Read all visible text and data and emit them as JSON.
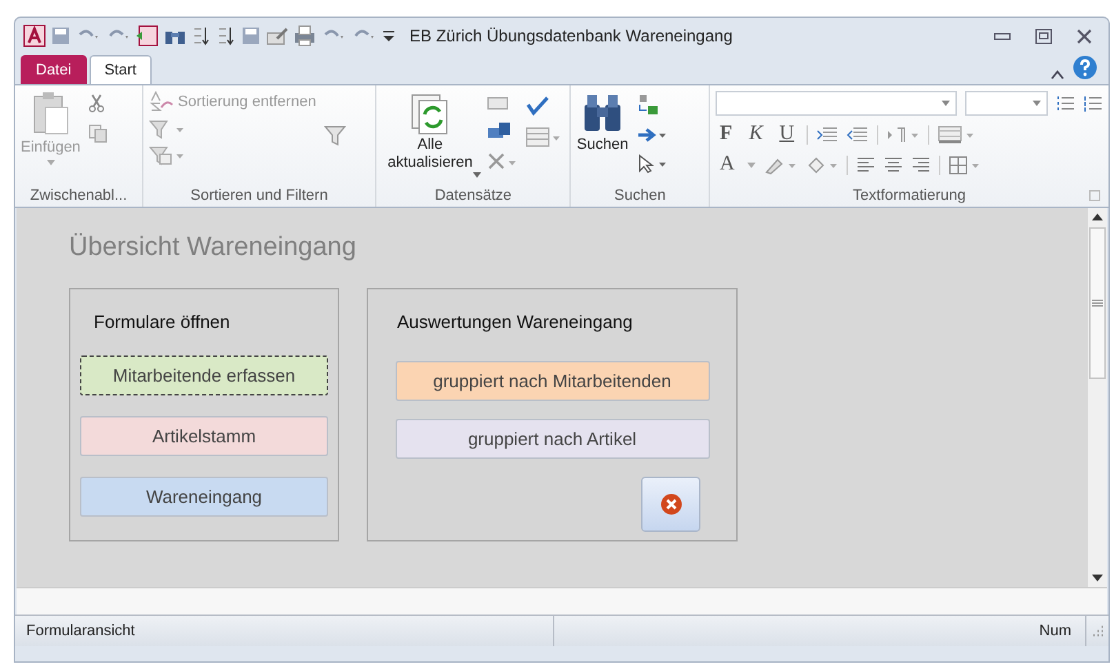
{
  "window": {
    "title": "EB Zürich Übungsdatenbank Wareneingang"
  },
  "tabs": [
    {
      "label": "Datei",
      "kind": "file",
      "selected": false
    },
    {
      "label": "Start",
      "kind": "tab",
      "selected": true
    }
  ],
  "ribbon": {
    "groups": [
      {
        "kind": "clipboard",
        "label": "Zwischenabl...",
        "texts": [
          "Einfügen"
        ]
      },
      {
        "kind": "sort",
        "label": "Sortieren und Filtern",
        "texts": [
          "Sortierung entfernen"
        ]
      },
      {
        "kind": "records",
        "label": "Datensätze",
        "texts": [
          "Alle",
          "aktualisieren"
        ]
      },
      {
        "kind": "find",
        "label": "Suchen",
        "texts": [
          "Suchen"
        ]
      },
      {
        "kind": "text",
        "label": "Textformatierung",
        "texts": [
          "F",
          "K",
          "U",
          "A"
        ]
      }
    ]
  },
  "form": {
    "title": "Übersicht Wareneingang",
    "panels": [
      {
        "title": "Formulare öffnen",
        "close_button": false,
        "buttons": [
          {
            "label": "Mitarbeitende erfassen",
            "color": "#d9e9c6",
            "focused": true
          },
          {
            "label": "Artikelstamm",
            "color": "#f3dada",
            "focused": false
          },
          {
            "label": "Wareneingang",
            "color": "#c8daf1",
            "focused": false
          }
        ]
      },
      {
        "title": "Auswertungen Wareneingang",
        "close_button": true,
        "buttons": [
          {
            "label": "gruppiert nach Mitarbeitenden",
            "color": "#fbd4b2",
            "focused": false
          },
          {
            "label": "gruppiert nach Artikel",
            "color": "#e5e2ef",
            "focused": false
          }
        ]
      }
    ]
  },
  "status_bar": {
    "left": "Formularansicht",
    "right": "Num"
  }
}
